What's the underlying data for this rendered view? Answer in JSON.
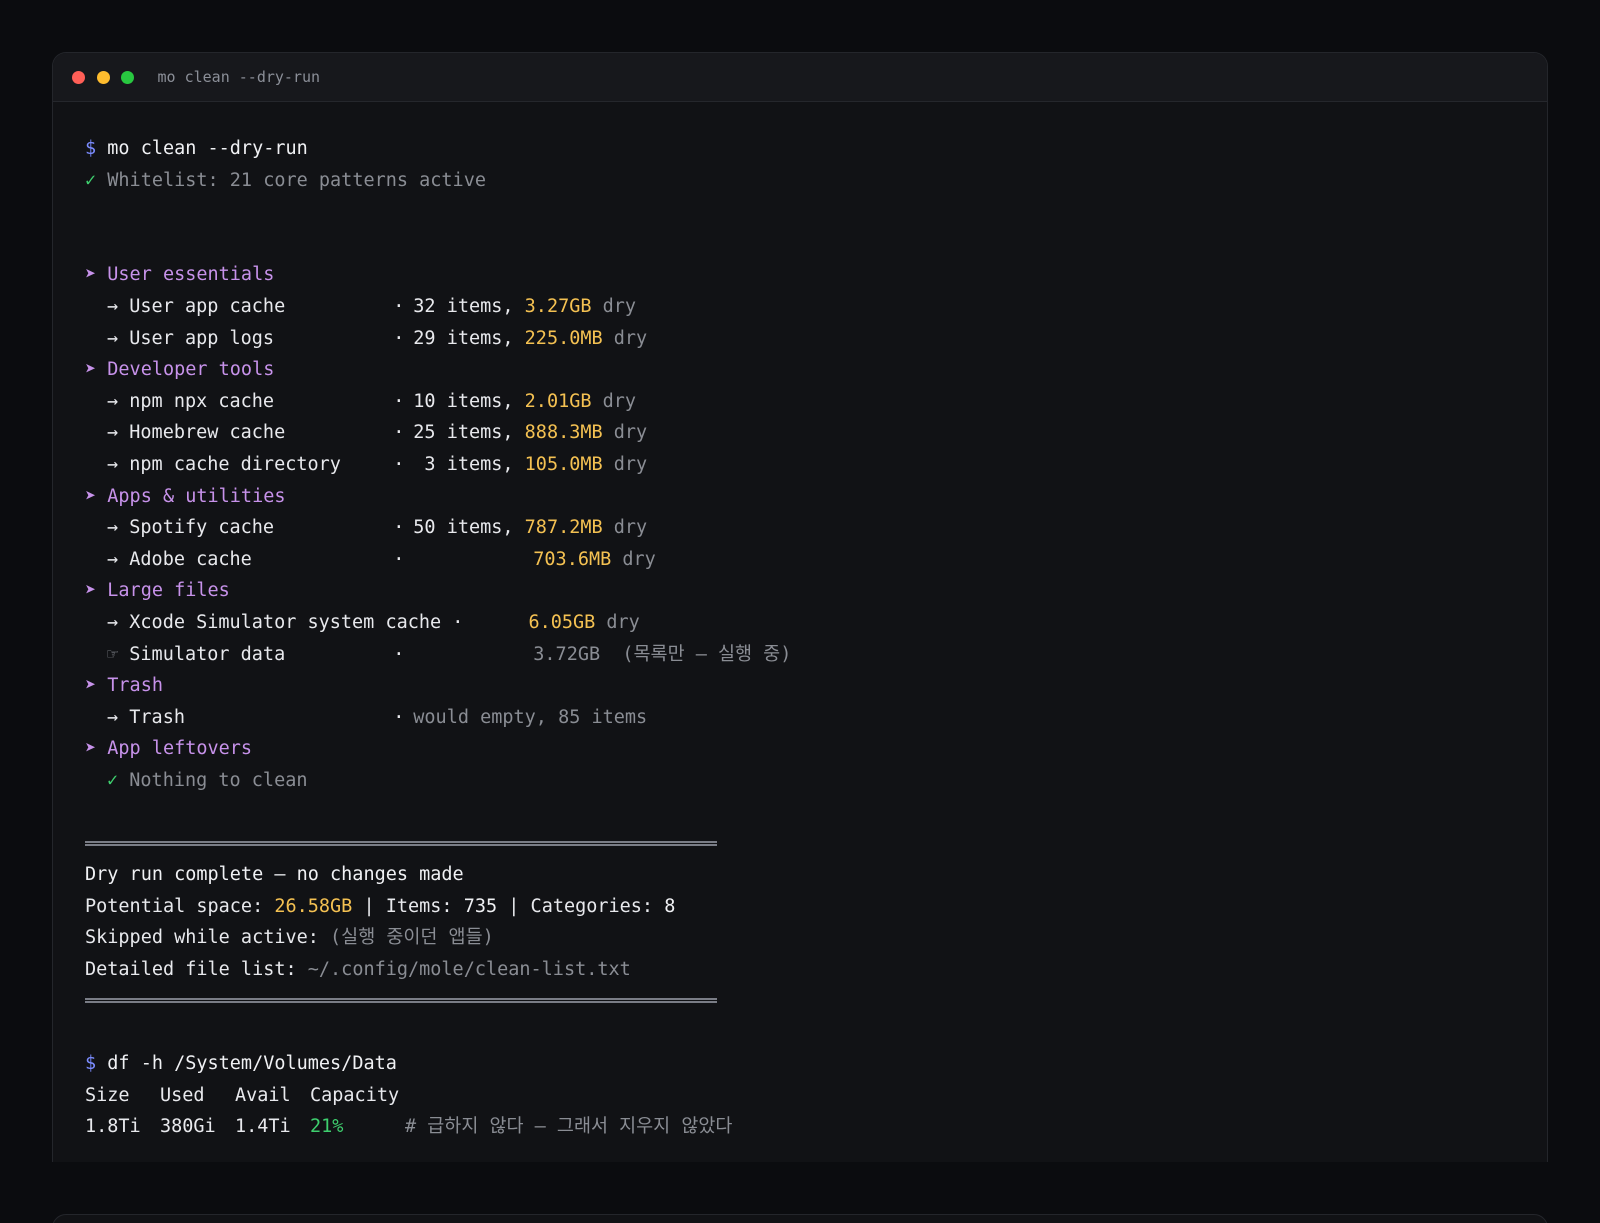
{
  "window": {
    "title": "mo clean --dry-run"
  },
  "prompt_symbol": "$",
  "check_symbol": "✓",
  "section_symbol": "➤",
  "arrow_symbol": "→",
  "hand_symbol": "☞",
  "dot_symbol": "·",
  "command1": "mo clean --dry-run",
  "whitelist": "Whitelist: 21 core patterns active",
  "sections": [
    {
      "title": "User essentials",
      "items": [
        {
          "name": "User app cache",
          "count": "32 items,",
          "size": "3.27GB",
          "tag": "dry"
        },
        {
          "name": "User app logs",
          "count": "29 items,",
          "size": "225.0MB",
          "tag": "dry"
        }
      ]
    },
    {
      "title": "Developer tools",
      "items": [
        {
          "name": "npm npx cache",
          "count": "10 items,",
          "size": "2.01GB",
          "tag": "dry"
        },
        {
          "name": "Homebrew cache",
          "count": "25 items,",
          "size": "888.3MB",
          "tag": "dry"
        },
        {
          "name": "npm cache directory",
          "count": " 3 items,",
          "size": "105.0MB",
          "tag": "dry"
        }
      ]
    },
    {
      "title": "Apps & utilities",
      "items": [
        {
          "name": "Spotify cache",
          "count": "50 items,",
          "size": "787.2MB",
          "tag": "dry"
        },
        {
          "name": "Adobe cache",
          "count": "",
          "size": "703.6MB",
          "tag": "dry"
        }
      ]
    },
    {
      "title": "Large files",
      "items": [
        {
          "name": "Xcode Simulator system cache",
          "count": "",
          "size": "6.05GB",
          "tag": "dry"
        },
        {
          "name": "Simulator data",
          "count": "",
          "size": "3.72GB",
          "tag": "(목록만 — 실행 중)"
        }
      ]
    },
    {
      "title": "Trash",
      "items": [
        {
          "name": "Trash",
          "note": "would empty, 85 items"
        }
      ]
    },
    {
      "title": "App leftovers",
      "nothing": "Nothing to clean"
    }
  ],
  "summary": {
    "line1": "Dry run complete — no changes made",
    "space_label": "Potential space: ",
    "space_value": "26.58GB",
    "items_sep": " | Items: ",
    "items_value": "735",
    "cat_sep": " | Categories: ",
    "cat_value": "8",
    "skipped_label": "Skipped while active: ",
    "skipped_value": "(실행 중이던 앱들)",
    "list_label": "Detailed file list: ",
    "list_value": "~/.config/mole/clean-list.txt"
  },
  "command2": "df -h /System/Volumes/Data",
  "df": {
    "headers": [
      "Size",
      "Used",
      "Avail",
      "Capacity"
    ],
    "row": [
      "1.8Ti",
      "380Gi",
      "1.4Ti",
      "21%"
    ],
    "comment": "# 급하지 않다 — 그래서 지우지 않았다"
  },
  "colors": {
    "prompt": "#7b8cff",
    "check": "#3ecf6e",
    "section": "#c792ea",
    "size": "#f4c152",
    "dim": "#8a8d94"
  }
}
